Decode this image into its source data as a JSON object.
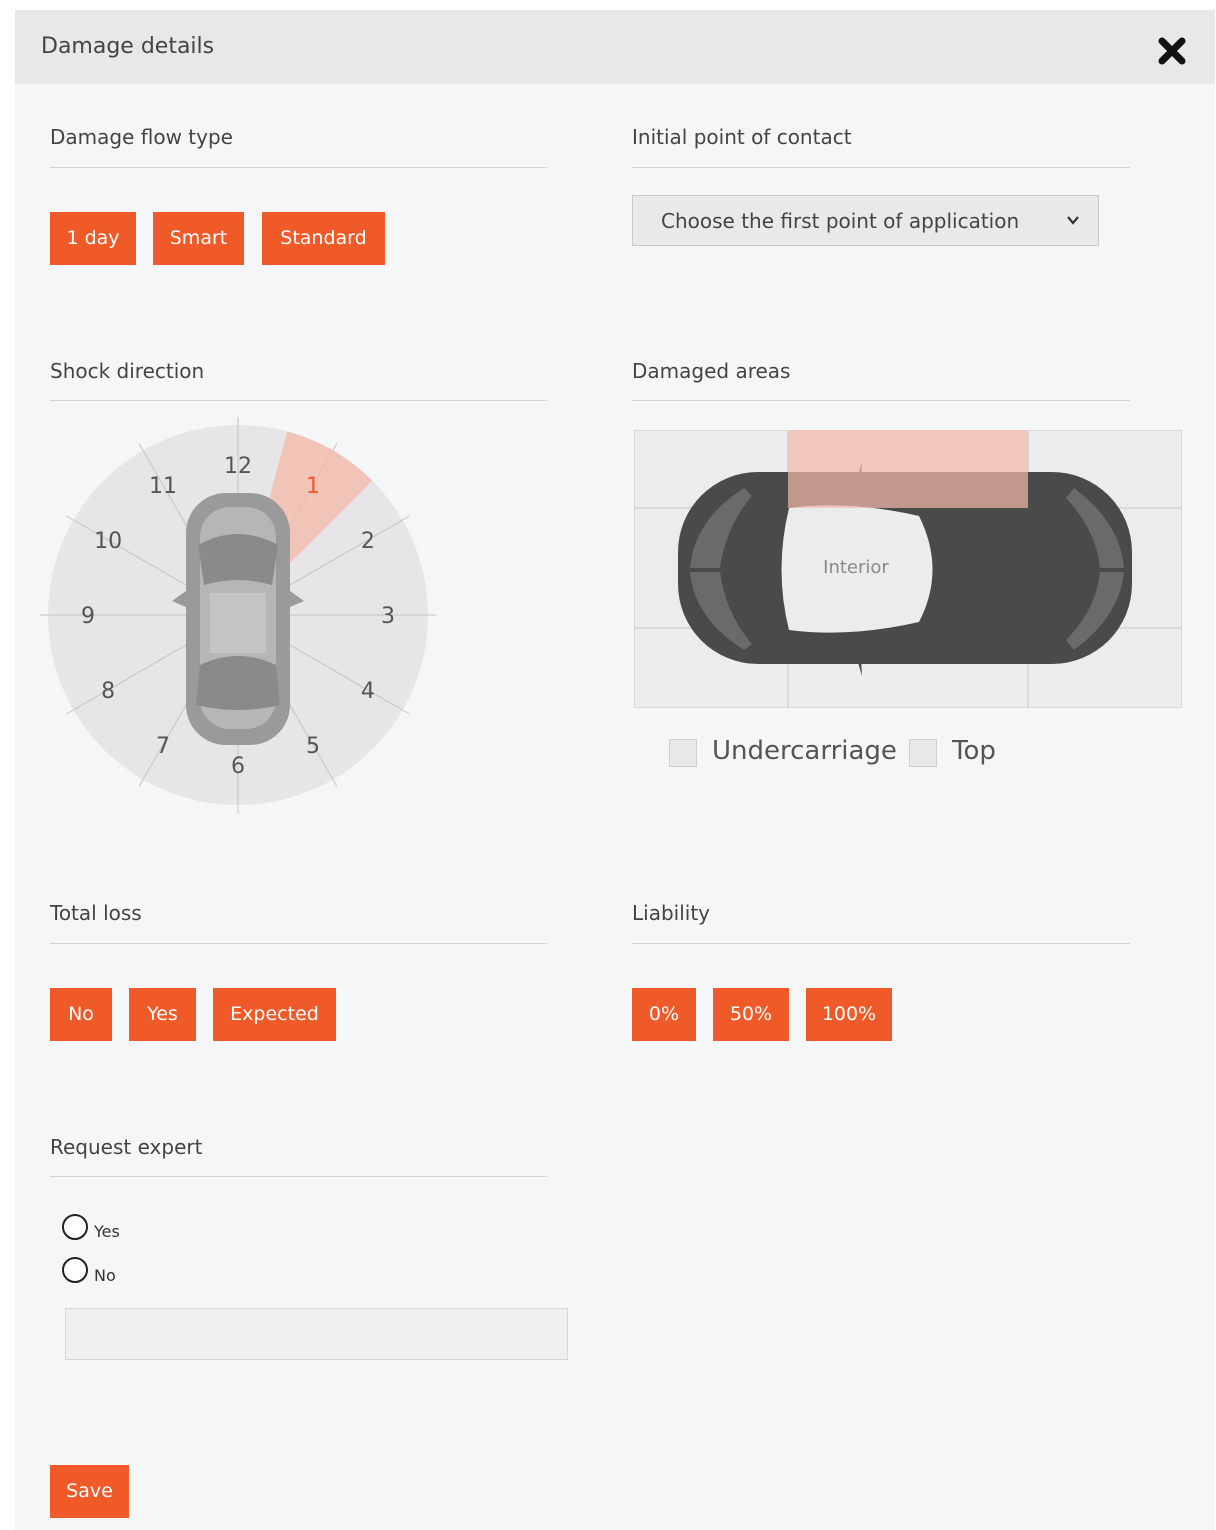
{
  "dialog": {
    "title": "Damage details"
  },
  "flow_type": {
    "title": "Damage flow type",
    "options": [
      "1 day",
      "Smart",
      "Standard"
    ]
  },
  "initial_contact": {
    "title": "Initial point of contact",
    "select_value": "Choose the first point of application"
  },
  "shock_direction": {
    "title": "Shock direction",
    "hours": [
      "12",
      "1",
      "2",
      "3",
      "4",
      "5",
      "6",
      "7",
      "8",
      "9",
      "10",
      "11"
    ],
    "selected_hour": "1"
  },
  "damaged_areas": {
    "title": "Damaged areas",
    "interior_label": "Interior",
    "selected_zone": "top-middle",
    "checkboxes": [
      {
        "label": "Undercarriage",
        "checked": false
      },
      {
        "label": "Top",
        "checked": false
      }
    ]
  },
  "total_loss": {
    "title": "Total loss",
    "options": [
      "No",
      "Yes",
      "Expected"
    ]
  },
  "liability": {
    "title": "Liability",
    "options": [
      "0%",
      "50%",
      "100%"
    ]
  },
  "request_expert": {
    "title": "Request expert",
    "options": [
      "Yes",
      "No"
    ],
    "input_value": ""
  },
  "save_label": "Save",
  "colors": {
    "accent": "#f05a28",
    "highlight": "#f5b8a8",
    "car": "#4a4a4a",
    "car_light": "#999999"
  }
}
